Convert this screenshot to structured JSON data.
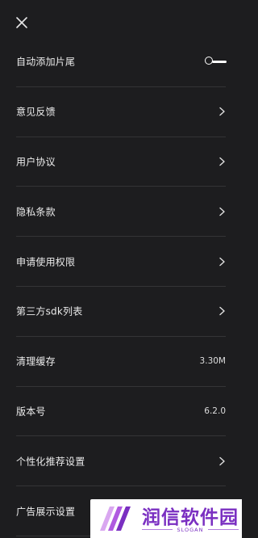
{
  "header": {
    "close_icon": "close-icon"
  },
  "settings": [
    {
      "id": "auto-add-ending",
      "label": "自动添加片尾",
      "type": "toggle",
      "enabled": false
    },
    {
      "id": "feedback",
      "label": "意见反馈",
      "type": "link"
    },
    {
      "id": "user-agreement",
      "label": "用户协议",
      "type": "link"
    },
    {
      "id": "privacy-policy",
      "label": "隐私条款",
      "type": "link"
    },
    {
      "id": "permissions",
      "label": "申请使用权限",
      "type": "link"
    },
    {
      "id": "third-party-sdk",
      "label": "第三方sdk列表",
      "type": "link"
    },
    {
      "id": "clear-cache",
      "label": "清理缓存",
      "type": "value",
      "value": "3.30M"
    },
    {
      "id": "version",
      "label": "版本号",
      "type": "value",
      "value": "6.2.0"
    },
    {
      "id": "personalized-recommend",
      "label": "个性化推荐设置",
      "type": "link"
    },
    {
      "id": "ad-display",
      "label": "广告展示设置",
      "type": "link"
    }
  ],
  "watermark": {
    "title": "润信软件园",
    "slogan": "SLOGAN",
    "color": "#7a2fc1"
  },
  "colors": {
    "background": "#1d1d1f",
    "divider": "#343436",
    "text": "#ececec"
  }
}
